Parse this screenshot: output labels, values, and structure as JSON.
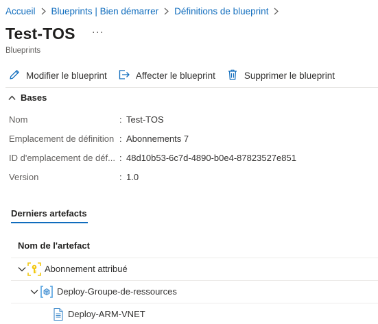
{
  "breadcrumb": {
    "items": [
      "Accueil",
      "Blueprints | Bien démarrer",
      "Définitions de blueprint"
    ]
  },
  "header": {
    "title": "Test-TOS",
    "more": "···",
    "subtitle": "Blueprints"
  },
  "toolbar": {
    "edit_label": "Modifier le blueprint",
    "assign_label": "Affecter le blueprint",
    "delete_label": "Supprimer le blueprint",
    "edit_icon": "pencil-icon",
    "assign_icon": "assign-arrow-icon",
    "delete_icon": "trash-icon"
  },
  "essentials": {
    "title": "Bases",
    "properties": [
      {
        "label": "Nom",
        "value": "Test-TOS"
      },
      {
        "label": "Emplacement de définition",
        "value": "Abonnements 7"
      },
      {
        "label": "ID d'emplacement de déf...",
        "value": "48d10b53-6c7d-4890-b0e4-87823527e851"
      },
      {
        "label": "Version",
        "value": "1.0"
      }
    ]
  },
  "artifacts": {
    "tab_label": "Derniers artefacts",
    "column_header": "Nom de l'artefact",
    "items": [
      {
        "name": "Abonnement attribué",
        "icon": "subscription-key-icon"
      },
      {
        "name": "Deploy-Groupe-de-ressources",
        "icon": "resource-group-icon"
      },
      {
        "name": "Deploy-ARM-VNET",
        "icon": "document-icon"
      }
    ]
  },
  "colors": {
    "link": "#0f6cbd",
    "subscription_key": "#f2c811",
    "resource_group": "#50a0e0"
  }
}
